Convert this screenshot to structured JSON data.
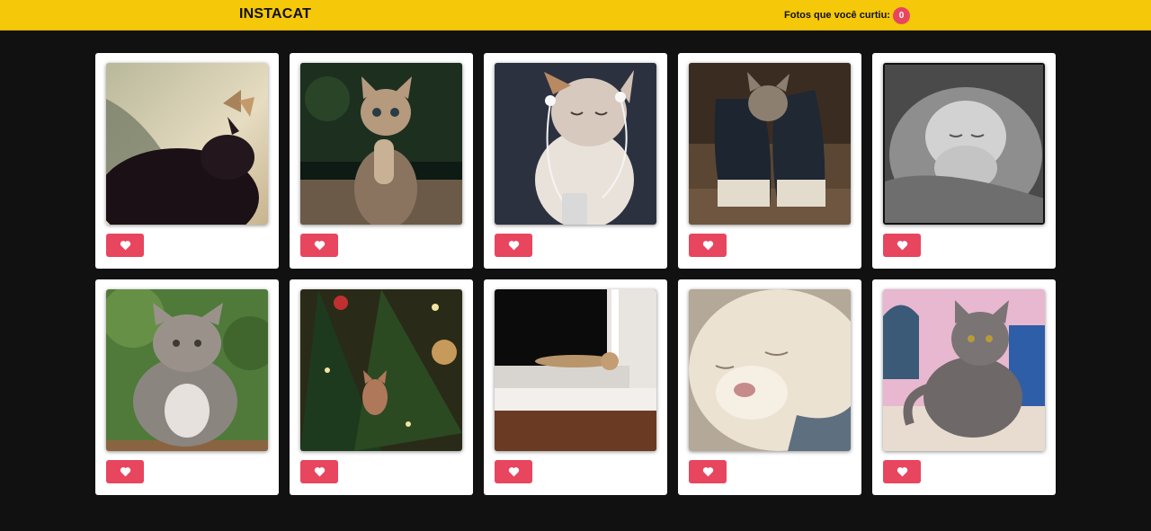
{
  "header": {
    "logo": "INSTACAT",
    "liked_label": "Fotos que você curtiu:",
    "liked_count": "0"
  },
  "colors": {
    "header_bg": "#f5c80a",
    "page_bg": "#111111",
    "accent": "#e8455f"
  },
  "photos": [
    {
      "subject": "black cat with butterfly",
      "icon": "heart-icon"
    },
    {
      "subject": "tabby kitten praying",
      "icon": "heart-icon"
    },
    {
      "subject": "kitten with earphones",
      "icon": "heart-icon"
    },
    {
      "subject": "kitten in sneakers",
      "icon": "heart-icon"
    },
    {
      "subject": "grey kitten in blanket",
      "icon": "heart-icon"
    },
    {
      "subject": "fat grey tabby cat",
      "icon": "heart-icon"
    },
    {
      "subject": "cat in christmas tree",
      "icon": "heart-icon"
    },
    {
      "subject": "cat on window sill",
      "icon": "heart-icon"
    },
    {
      "subject": "white cat closeup",
      "icon": "heart-icon"
    },
    {
      "subject": "grey british shorthair",
      "icon": "heart-icon"
    }
  ]
}
